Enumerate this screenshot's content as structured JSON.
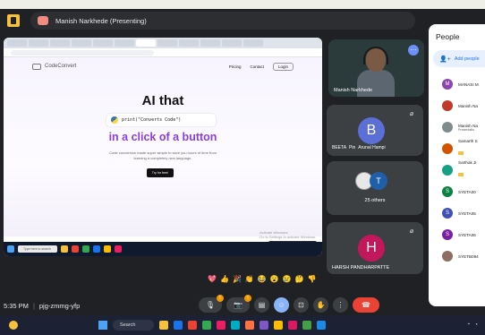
{
  "meeting": {
    "presenter_chip": "Manish Narkhede (Presenting)",
    "time": "5:35 PM",
    "separator": "|",
    "code": "pjg-zmmg-yfp"
  },
  "shared_screen": {
    "logo_text": "CodeConvert",
    "nav": [
      "Pricing",
      "Contact",
      "Login"
    ],
    "hero_title": "AI that",
    "code_snippet": "print(\"Converts Code\")",
    "hero_subtitle": "in a click of a button",
    "description": "Code conversion made super simple to save you hours of time from learning a completely new language.",
    "cta": "Try for free!",
    "watermark": "Activate Windows\nGo to Settings to activate Windows.",
    "taskbar_search": "Type here to search"
  },
  "tiles": [
    {
      "name": "Manish Narkhede"
    },
    {
      "avatar": "B",
      "names": [
        "BEETA",
        "Pin",
        "Arunal Hampi"
      ]
    },
    {
      "avatar_t": "T",
      "label": "25 others"
    },
    {
      "avatar": "H",
      "name": "HARSH PANDHARPATTE"
    }
  ],
  "reactions": [
    "💖",
    "👍",
    "🎉",
    "👏",
    "😂",
    "😮",
    "😢",
    "🤔",
    "👎"
  ],
  "people_panel": {
    "title": "People",
    "add_label": "Add people",
    "rows": [
      {
        "initial": "M",
        "color": "#8e44ad",
        "name": "MANASI M"
      },
      {
        "initial": "",
        "color": "#c0392b",
        "name": "Manish Na"
      },
      {
        "initial": "",
        "color": "#7f8c8d",
        "name": "Manish Na",
        "sub": "Presentatio"
      },
      {
        "initial": "",
        "color": "#d35400",
        "name": "Samarth S",
        "tag": true
      },
      {
        "initial": "",
        "color": "#16a085",
        "name": "Sarthak Ji",
        "tag": true
      },
      {
        "initial": "S",
        "color": "#0b8043",
        "name": "SYETA00"
      },
      {
        "initial": "S",
        "color": "#3f51b5",
        "name": "SYETA05"
      },
      {
        "initial": "S",
        "color": "#7b1fa2",
        "name": "SYETA06"
      },
      {
        "initial": "",
        "color": "#8d6e63",
        "name": "SYETB094"
      }
    ]
  },
  "win_taskbar": {
    "search": "Search"
  }
}
